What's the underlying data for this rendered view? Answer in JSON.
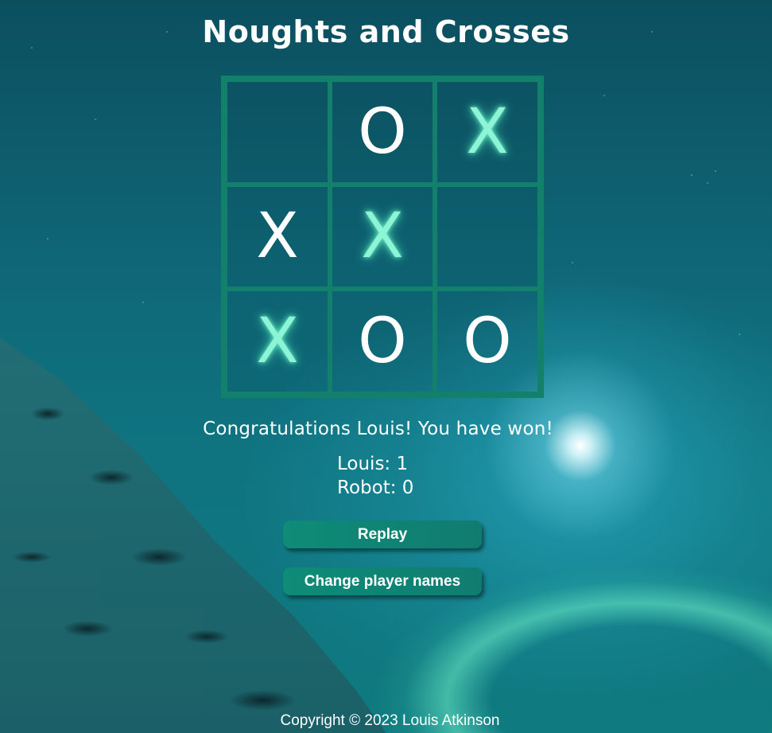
{
  "title": "Noughts and Crosses",
  "board": {
    "cells": [
      {
        "mark": "",
        "style": "empty"
      },
      {
        "mark": "O",
        "style": "o"
      },
      {
        "mark": "X",
        "style": "x-glow"
      },
      {
        "mark": "X",
        "style": "x-human"
      },
      {
        "mark": "X",
        "style": "x-glow"
      },
      {
        "mark": "",
        "style": "empty"
      },
      {
        "mark": "X",
        "style": "x-glow"
      },
      {
        "mark": "O",
        "style": "o"
      },
      {
        "mark": "O",
        "style": "o"
      }
    ]
  },
  "message": "Congratulations Louis! You have won!",
  "scores": {
    "player": "Louis: 1",
    "robot": "Robot: 0"
  },
  "buttons": {
    "replay": "Replay",
    "change_names": "Change player names"
  },
  "footer": "Copyright © 2023 Louis Atkinson",
  "colors": {
    "grid": "#12806a",
    "glow_mark": "#8df5d5",
    "button": "#0e8c78"
  }
}
